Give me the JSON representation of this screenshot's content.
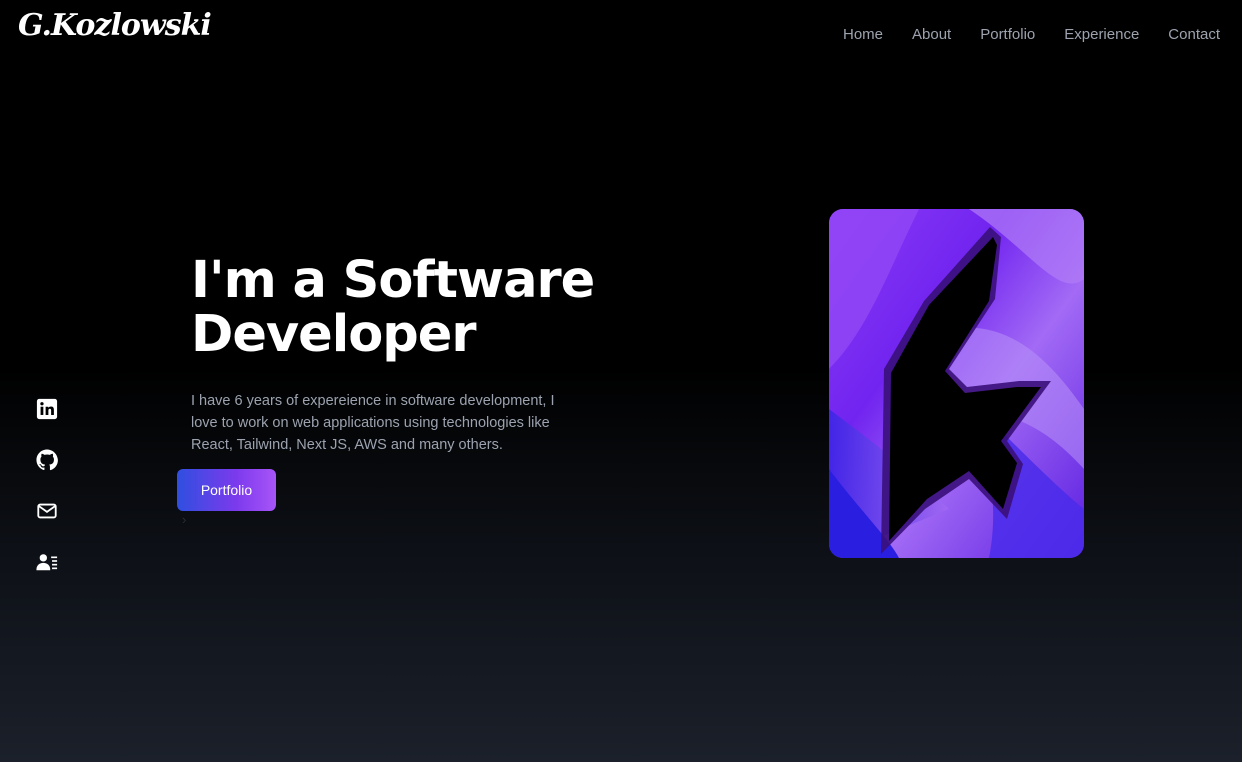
{
  "header": {
    "logo_text": "G.Kozlowski",
    "nav": [
      {
        "label": "Home"
      },
      {
        "label": "About"
      },
      {
        "label": "Portfolio"
      },
      {
        "label": "Experience"
      },
      {
        "label": "Contact"
      }
    ]
  },
  "social": {
    "icons": [
      "linkedin-icon",
      "github-icon",
      "mail-icon",
      "resume-icon"
    ]
  },
  "hero": {
    "title_line1": "I'm a Software",
    "title_line2": "Developer",
    "description": "I have 6 years of expereience in software development, I love to work on web applications using technologies like React, Tailwind, Next JS, AWS and many others.",
    "button_label": "Portfolio",
    "chevron": "›",
    "image_icon": "lightning-logo-image"
  },
  "colors": {
    "background": "#000000",
    "nav_text": "#9ca3af",
    "button_gradient_start": "#2f4fe0",
    "button_gradient_end": "#a855f7",
    "image_purple": "#7c2ff0"
  }
}
